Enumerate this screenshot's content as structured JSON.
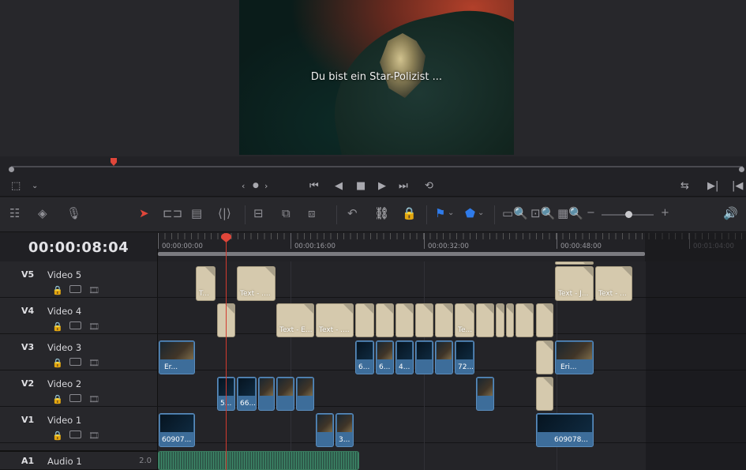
{
  "viewer": {
    "subtitle": "Du bist ein Star-Polizist ..."
  },
  "timecode": "00:00:08:04",
  "ruler": {
    "labels": [
      "00:00:00:00",
      "00:00:16:00",
      "00:00:32:00",
      "00:00:48:00",
      "00:01:04:00"
    ]
  },
  "tracks": [
    {
      "id": "V5",
      "name": "Video 5"
    },
    {
      "id": "V4",
      "name": "Video 4"
    },
    {
      "id": "V3",
      "name": "Video 3"
    },
    {
      "id": "V2",
      "name": "Video 2"
    },
    {
      "id": "V1",
      "name": "Video 1"
    },
    {
      "id": "A1",
      "name": "Audio 1",
      "channels": "2.0"
    }
  ],
  "clips": {
    "v5": [
      "T...",
      "Text - ....",
      "Text - J...",
      "Text - ..."
    ],
    "v4": [
      "Text - E...",
      "Text - ....",
      "Te..."
    ],
    "v3": [
      "Er...",
      "6...",
      "6...",
      "4...",
      "72...",
      "Eri..."
    ],
    "v2": [
      "5...",
      "66..."
    ],
    "v1": [
      "60907...",
      "3...",
      "609078..."
    ]
  },
  "colors": {
    "accent": "#e0463a",
    "video_clip": "#3d6d9a",
    "text_clip": "#d5c9ad",
    "flag_blue": "#2f7bea"
  }
}
